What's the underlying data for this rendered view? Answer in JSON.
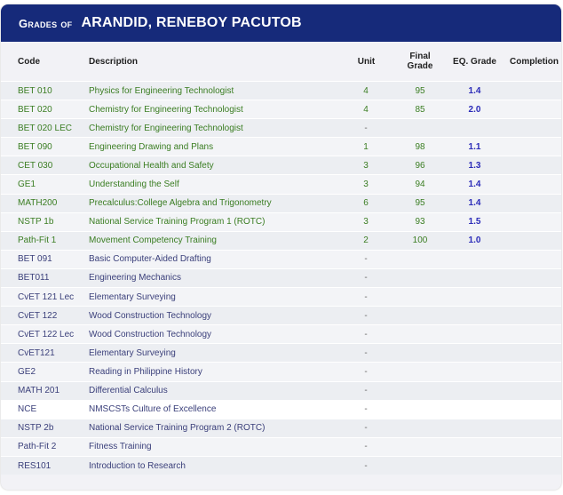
{
  "header": {
    "prefix": "Grades of",
    "student_name": "ARANDID, RENEBOY PACUTOB"
  },
  "columns": {
    "code": "Code",
    "description": "Description",
    "unit": "Unit",
    "final_grade_line1": "Final",
    "final_grade_line2": "Grade",
    "eq_grade": "EQ. Grade",
    "completion": "Completion"
  },
  "rows": [
    {
      "code": "BET 010",
      "description": "Physics for Engineering Technologist",
      "unit": "4",
      "final": "95",
      "eq": "1.4",
      "completion": "",
      "status": "graded"
    },
    {
      "code": "BET 020",
      "description": "Chemistry for Engineering Technologist",
      "unit": "4",
      "final": "85",
      "eq": "2.0",
      "completion": "",
      "status": "graded"
    },
    {
      "code": "BET 020 LEC",
      "description": "Chemistry for Engineering Technologist",
      "unit": "-",
      "final": "",
      "eq": "",
      "completion": "",
      "status": "graded"
    },
    {
      "code": "BET 090",
      "description": "Engineering Drawing and Plans",
      "unit": "1",
      "final": "98",
      "eq": "1.1",
      "completion": "",
      "status": "graded"
    },
    {
      "code": "CET 030",
      "description": "Occupational Health and Safety",
      "unit": "3",
      "final": "96",
      "eq": "1.3",
      "completion": "",
      "status": "graded"
    },
    {
      "code": "GE1",
      "description": "Understanding the Self",
      "unit": "3",
      "final": "94",
      "eq": "1.4",
      "completion": "",
      "status": "graded"
    },
    {
      "code": "MATH200",
      "description": "Precalculus:College Algebra and Trigonometry",
      "unit": "6",
      "final": "95",
      "eq": "1.4",
      "completion": "",
      "status": "graded"
    },
    {
      "code": "NSTP 1b",
      "description": "National Service Training Program 1 (ROTC)",
      "unit": "3",
      "final": "93",
      "eq": "1.5",
      "completion": "",
      "status": "graded"
    },
    {
      "code": "Path-Fit 1",
      "description": "Movement Competency Training",
      "unit": "2",
      "final": "100",
      "eq": "1.0",
      "completion": "",
      "status": "graded"
    },
    {
      "code": "BET 091",
      "description": "Basic Computer-Aided Drafting",
      "unit": "-",
      "final": "",
      "eq": "",
      "completion": "",
      "status": "pending"
    },
    {
      "code": "BET011",
      "description": "Engineering Mechanics",
      "unit": "-",
      "final": "",
      "eq": "",
      "completion": "",
      "status": "pending"
    },
    {
      "code": "CvET 121 Lec",
      "description": "Elementary Surveying",
      "unit": "-",
      "final": "",
      "eq": "",
      "completion": "",
      "status": "pending"
    },
    {
      "code": "CvET 122",
      "description": "Wood Construction Technology",
      "unit": "-",
      "final": "",
      "eq": "",
      "completion": "",
      "status": "pending"
    },
    {
      "code": "CvET 122 Lec",
      "description": "Wood Construction Technology",
      "unit": "-",
      "final": "",
      "eq": "",
      "completion": "",
      "status": "pending"
    },
    {
      "code": "CvET121",
      "description": "Elementary Surveying",
      "unit": "-",
      "final": "",
      "eq": "",
      "completion": "",
      "status": "pending"
    },
    {
      "code": "GE2",
      "description": "Reading in Philippine History",
      "unit": "-",
      "final": "",
      "eq": "",
      "completion": "",
      "status": "pending"
    },
    {
      "code": "MATH 201",
      "description": "Differential Calculus",
      "unit": "-",
      "final": "",
      "eq": "",
      "completion": "",
      "status": "pending"
    },
    {
      "code": "NCE",
      "description": "NMSCSTs Culture of Excellence",
      "unit": "-",
      "final": "",
      "eq": "",
      "completion": "",
      "status": "pending"
    },
    {
      "code": "NSTP 2b",
      "description": "National Service Training Program 2 (ROTC)",
      "unit": "-",
      "final": "",
      "eq": "",
      "completion": "",
      "status": "pending"
    },
    {
      "code": "Path-Fit 2",
      "description": "Fitness Training",
      "unit": "-",
      "final": "",
      "eq": "",
      "completion": "",
      "status": "pending"
    },
    {
      "code": "RES101",
      "description": "Introduction to Research",
      "unit": "-",
      "final": "",
      "eq": "",
      "completion": "",
      "status": "pending"
    }
  ],
  "colors": {
    "header_bg": "#162a7a",
    "graded_text": "#3a7d22",
    "pending_text": "#3a3f7a",
    "eq_grade_text": "#2a2ab8"
  }
}
